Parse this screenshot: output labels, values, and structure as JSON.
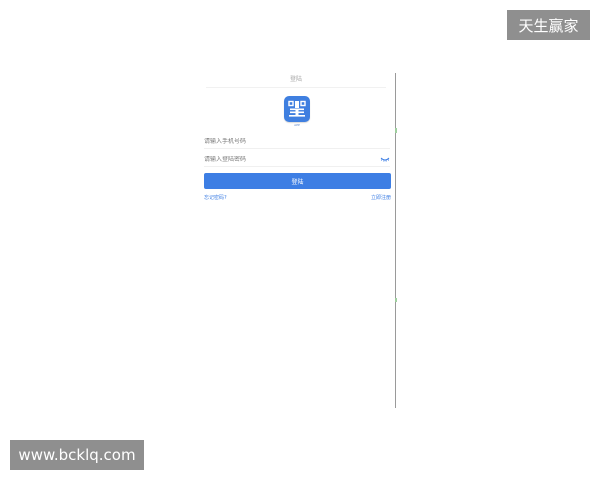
{
  "watermarks": {
    "top_right": "天生赢家",
    "bottom_left": "www.bcklq.com"
  },
  "login_screen": {
    "nav_title": "登陆",
    "logo_caption": "APP",
    "phone_placeholder": "请输入手机号码",
    "password_placeholder": "请输入登陆密码",
    "login_button": "登陆",
    "forgot_password_link": "忘记密码?",
    "register_link": "立即注册",
    "password_visibility_icon": "eye-icon",
    "accent_color": "#3d7ee4"
  }
}
